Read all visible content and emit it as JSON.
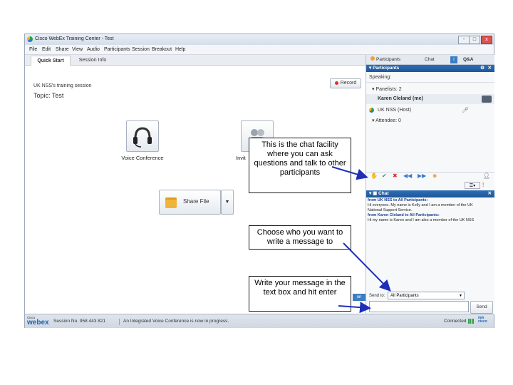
{
  "window": {
    "title": "Cisco WebEx Training Center - Test",
    "controls": [
      "-",
      "□",
      "x"
    ]
  },
  "menu": [
    "File",
    "Edit",
    "Share",
    "View",
    "Audio",
    "Participants",
    "Session",
    "Breakout",
    "Help"
  ],
  "tabs": {
    "quick_start": "Quick Start",
    "session_info": "Session Info"
  },
  "main": {
    "session_name": "UK NSS's training session",
    "topic": "Topic:  Test",
    "record_label": "Record",
    "voice_conference_label": "Voice Conference",
    "invite_label_partial": "Invit",
    "share_file_label": "Share File"
  },
  "right_panel": {
    "tabs": [
      "Participants",
      "Chat",
      "Q&A"
    ],
    "participants_header": "Participants",
    "speaking_label": "Speaking:",
    "panelists_label": "Panelists: 2",
    "panelist_1": "Karen Cleland (me)",
    "panelist_2": "UK NSS (Host)",
    "attendees_label": "Attendee: 0",
    "chat_header": "Chat",
    "chat_messages": [
      {
        "from": "from UK NSS to All Participants:",
        "text": "Hi everyone. My name is Kelly and I am a member of the UK National Support Service."
      },
      {
        "from": "from Karen Cleland to All Participants:",
        "text": "Hi my name is Karen and I am also a member of the UK NSS"
      }
    ],
    "send_to_label": "Send to:",
    "send_to_value": "All Participants",
    "send_button": "Send"
  },
  "status_bar": {
    "brand_small": "Cisco",
    "brand": "webex",
    "session_number": "Session No. 958 443 821",
    "message": "An Integrated Voice Conference is now in progress.",
    "connection": "Connected"
  },
  "callouts": {
    "chat_facility": "This is the chat facility where you can ask questions and talk to other participants",
    "choose": "Choose who you want to write a message to",
    "write": "Write your message in the text box and hit enter"
  },
  "colors": {
    "arrow": "#1f2fb8",
    "header_blue": "#2463aa",
    "accent_orange": "#f0a030"
  }
}
